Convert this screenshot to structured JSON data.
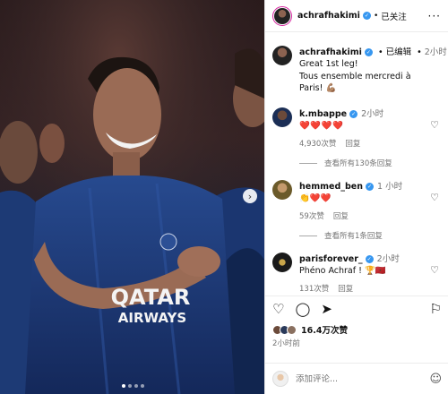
{
  "post": {
    "author": "achrafhakimi",
    "follow_state": "已关注",
    "separator": "•",
    "caption_edit": "已编辑",
    "caption_time": "2小时",
    "caption_lines": [
      "Great 1st leg!",
      "Tous ensemble mercredi à Paris! 💪🏽"
    ],
    "likes": "16.4万次赞",
    "time": "2小时前"
  },
  "photo": {
    "jersey_sponsor_line1": "QATAR",
    "jersey_sponsor_line2": "AIRWAYS",
    "carousel_dots": 4,
    "active_dot": 1
  },
  "comments": [
    {
      "user": "k.mbappe",
      "time": "2小时",
      "text": "❤️❤️❤️❤️",
      "likes": "4,930次赞",
      "reply": "回复",
      "view_replies": "查看所有130条回复"
    },
    {
      "user": "hemmed_ben",
      "time": "1 小时",
      "text": "👏❤️❤️",
      "likes": "59次赞",
      "reply": "回复",
      "view_replies": "查看所有1条回复"
    },
    {
      "user": "parisforever_",
      "time": "2小时",
      "text": "Phéno Achraf ! 🏆🇲🇦",
      "likes": "131次赞",
      "reply": "回复"
    }
  ],
  "composer": {
    "placeholder": "添加评论..."
  },
  "icons": {
    "verified": "verified-badge-icon",
    "more": "more-options-icon",
    "like": "heart-icon",
    "comment": "comment-icon",
    "share": "share-icon",
    "save": "bookmark-icon",
    "emoji": "emoji-icon",
    "next": "chevron-right-icon"
  },
  "colors": {
    "verified": "#3797f0",
    "jersey": "#1f3b78",
    "accent_red": "#ed4956"
  }
}
